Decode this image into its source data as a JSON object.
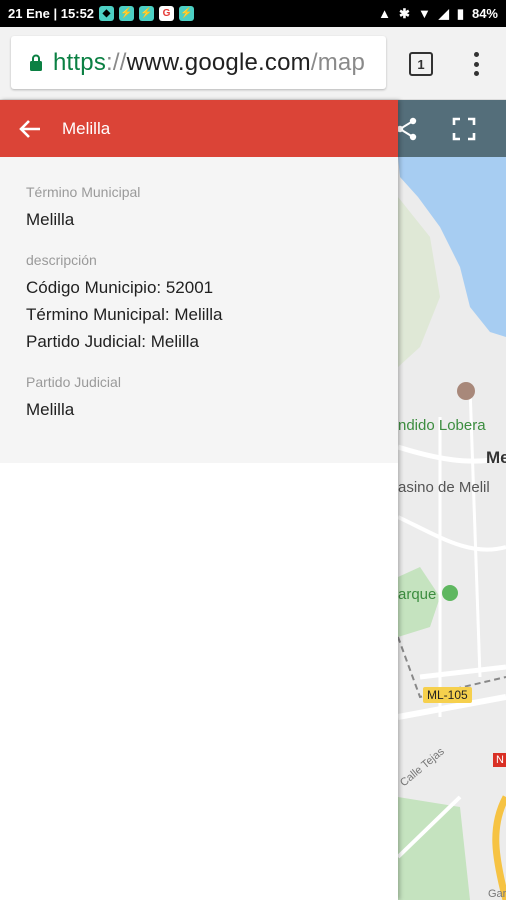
{
  "status_bar": {
    "datetime": "21 Ene | 15:52",
    "battery": "84%",
    "notification_icons": [
      "shield-icon",
      "app-icon",
      "app-icon",
      "google-icon",
      "app-icon"
    ]
  },
  "browser": {
    "url_scheme": "https",
    "url_separator": "://",
    "url_host": "www.google.com",
    "url_path": "/map",
    "tab_count": "1"
  },
  "map": {
    "labels": {
      "place1": "ndido Lobera",
      "place2": "Me",
      "place3": "asino de Melil",
      "park": "arque",
      "road": "ML-105",
      "street": "Calle Tejas",
      "station": "Gare Of",
      "route_badge": "N"
    },
    "colors": {
      "water": "#a7cdf2",
      "land": "#ececec",
      "park": "#c5e3bf",
      "toolbar": "#546e7a"
    }
  },
  "panel": {
    "title": "Melilla",
    "header_color": "#db4437",
    "fields": [
      {
        "label": "Término Municipal",
        "lines": [
          "Melilla"
        ]
      },
      {
        "label": "descripción",
        "lines": [
          "Código Municipio: 52001",
          "Término Municipal: Melilla",
          "Partido Judicial: Melilla"
        ]
      },
      {
        "label": "Partido Judicial",
        "lines": [
          "Melilla"
        ]
      }
    ]
  }
}
